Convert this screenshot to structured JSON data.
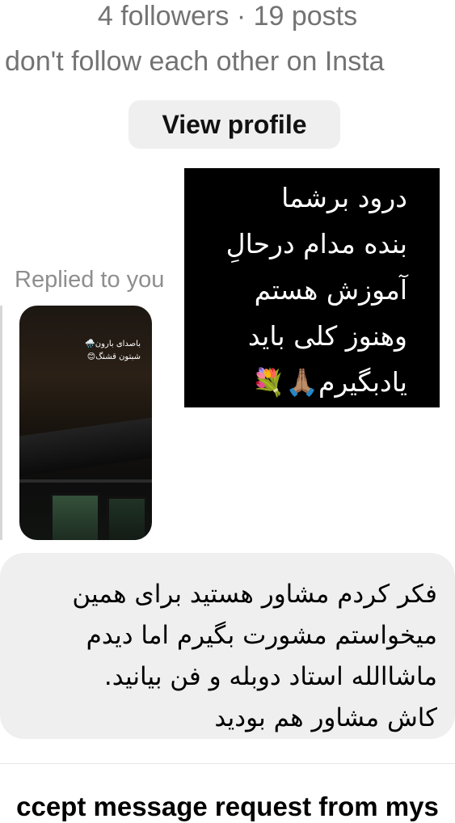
{
  "profile": {
    "stats": "4 followers · 19 posts",
    "follow_note": "don't follow each other on Insta",
    "view_profile_label": "View profile"
  },
  "thread": {
    "replied_label": "Replied to you",
    "sent_image_text": "درود برشما\nبنده مدام درحالِ\nآموزش هستم\nوهنوز کلی باید\nیادبگیرم🙏🏽💐",
    "story_caption": "باصدای بارون🌧️\nشبتون قشنگ😊",
    "received_message": "فکر کردم مشاور هستید برای همین\nمیخواستم مشورت بگیرم اما دیدم\nماشاالله استاد دوبله و فن بیانید.\nکاش مشاور هم بودید"
  },
  "footer": {
    "accept_heading": "ccept message request from mys"
  }
}
